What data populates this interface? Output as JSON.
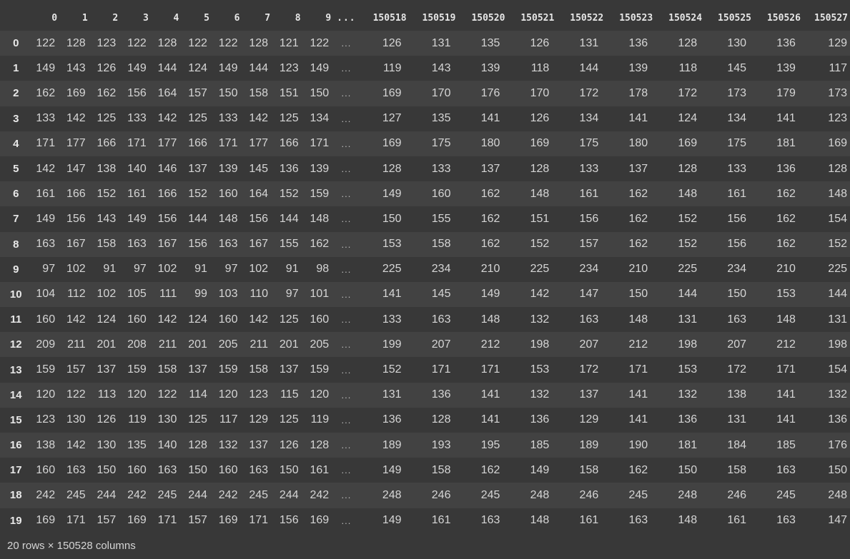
{
  "table": {
    "index_header": "",
    "left_columns": [
      "0",
      "1",
      "2",
      "3",
      "4",
      "5",
      "6",
      "7",
      "8",
      "9"
    ],
    "ellipsis": "...",
    "right_columns": [
      "150518",
      "150519",
      "150520",
      "150521",
      "150522",
      "150523",
      "150524",
      "150525",
      "150526",
      "150527"
    ],
    "rows": [
      {
        "index": "0",
        "left": [
          "122",
          "128",
          "123",
          "122",
          "128",
          "122",
          "122",
          "128",
          "121",
          "122"
        ],
        "right": [
          "126",
          "131",
          "135",
          "126",
          "131",
          "136",
          "128",
          "130",
          "136",
          "129"
        ]
      },
      {
        "index": "1",
        "left": [
          "149",
          "143",
          "126",
          "149",
          "144",
          "124",
          "149",
          "144",
          "123",
          "149"
        ],
        "right": [
          "119",
          "143",
          "139",
          "118",
          "144",
          "139",
          "118",
          "145",
          "139",
          "117"
        ]
      },
      {
        "index": "2",
        "left": [
          "162",
          "169",
          "162",
          "156",
          "164",
          "157",
          "150",
          "158",
          "151",
          "150"
        ],
        "right": [
          "169",
          "170",
          "176",
          "170",
          "172",
          "178",
          "172",
          "173",
          "179",
          "173"
        ]
      },
      {
        "index": "3",
        "left": [
          "133",
          "142",
          "125",
          "133",
          "142",
          "125",
          "133",
          "142",
          "125",
          "134"
        ],
        "right": [
          "127",
          "135",
          "141",
          "126",
          "134",
          "141",
          "124",
          "134",
          "141",
          "123"
        ]
      },
      {
        "index": "4",
        "left": [
          "171",
          "177",
          "166",
          "171",
          "177",
          "166",
          "171",
          "177",
          "166",
          "171"
        ],
        "right": [
          "169",
          "175",
          "180",
          "169",
          "175",
          "180",
          "169",
          "175",
          "181",
          "169"
        ]
      },
      {
        "index": "5",
        "left": [
          "142",
          "147",
          "138",
          "140",
          "146",
          "137",
          "139",
          "145",
          "136",
          "139"
        ],
        "right": [
          "128",
          "133",
          "137",
          "128",
          "133",
          "137",
          "128",
          "133",
          "136",
          "128"
        ]
      },
      {
        "index": "6",
        "left": [
          "161",
          "166",
          "152",
          "161",
          "166",
          "152",
          "160",
          "164",
          "152",
          "159"
        ],
        "right": [
          "149",
          "160",
          "162",
          "148",
          "161",
          "162",
          "148",
          "161",
          "162",
          "148"
        ]
      },
      {
        "index": "7",
        "left": [
          "149",
          "156",
          "143",
          "149",
          "156",
          "144",
          "148",
          "156",
          "144",
          "148"
        ],
        "right": [
          "150",
          "155",
          "162",
          "151",
          "156",
          "162",
          "152",
          "156",
          "162",
          "154"
        ]
      },
      {
        "index": "8",
        "left": [
          "163",
          "167",
          "158",
          "163",
          "167",
          "156",
          "163",
          "167",
          "155",
          "162"
        ],
        "right": [
          "153",
          "158",
          "162",
          "152",
          "157",
          "162",
          "152",
          "156",
          "162",
          "152"
        ]
      },
      {
        "index": "9",
        "left": [
          "97",
          "102",
          "91",
          "97",
          "102",
          "91",
          "97",
          "102",
          "91",
          "98"
        ],
        "right": [
          "225",
          "234",
          "210",
          "225",
          "234",
          "210",
          "225",
          "234",
          "210",
          "225"
        ]
      },
      {
        "index": "10",
        "left": [
          "104",
          "112",
          "102",
          "105",
          "111",
          "99",
          "103",
          "110",
          "97",
          "101"
        ],
        "right": [
          "141",
          "145",
          "149",
          "142",
          "147",
          "150",
          "144",
          "150",
          "153",
          "144"
        ]
      },
      {
        "index": "11",
        "left": [
          "160",
          "142",
          "124",
          "160",
          "142",
          "124",
          "160",
          "142",
          "125",
          "160"
        ],
        "right": [
          "133",
          "163",
          "148",
          "132",
          "163",
          "148",
          "131",
          "163",
          "148",
          "131"
        ]
      },
      {
        "index": "12",
        "left": [
          "209",
          "211",
          "201",
          "208",
          "211",
          "201",
          "205",
          "211",
          "201",
          "205"
        ],
        "right": [
          "199",
          "207",
          "212",
          "198",
          "207",
          "212",
          "198",
          "207",
          "212",
          "198"
        ]
      },
      {
        "index": "13",
        "left": [
          "159",
          "157",
          "137",
          "159",
          "158",
          "137",
          "159",
          "158",
          "137",
          "159"
        ],
        "right": [
          "152",
          "171",
          "171",
          "153",
          "172",
          "171",
          "153",
          "172",
          "171",
          "154"
        ]
      },
      {
        "index": "14",
        "left": [
          "120",
          "122",
          "113",
          "120",
          "122",
          "114",
          "120",
          "123",
          "115",
          "120"
        ],
        "right": [
          "131",
          "136",
          "141",
          "132",
          "137",
          "141",
          "132",
          "138",
          "141",
          "132"
        ]
      },
      {
        "index": "15",
        "left": [
          "123",
          "130",
          "126",
          "119",
          "130",
          "125",
          "117",
          "129",
          "125",
          "119"
        ],
        "right": [
          "136",
          "128",
          "141",
          "136",
          "129",
          "141",
          "136",
          "131",
          "141",
          "136"
        ]
      },
      {
        "index": "16",
        "left": [
          "138",
          "142",
          "130",
          "135",
          "140",
          "128",
          "132",
          "137",
          "126",
          "128"
        ],
        "right": [
          "189",
          "193",
          "195",
          "185",
          "189",
          "190",
          "181",
          "184",
          "185",
          "176"
        ]
      },
      {
        "index": "17",
        "left": [
          "160",
          "163",
          "150",
          "160",
          "163",
          "150",
          "160",
          "163",
          "150",
          "161"
        ],
        "right": [
          "149",
          "158",
          "162",
          "149",
          "158",
          "162",
          "150",
          "158",
          "163",
          "150"
        ]
      },
      {
        "index": "18",
        "left": [
          "242",
          "245",
          "244",
          "242",
          "245",
          "244",
          "242",
          "245",
          "244",
          "242"
        ],
        "right": [
          "248",
          "246",
          "245",
          "248",
          "246",
          "245",
          "248",
          "246",
          "245",
          "248"
        ]
      },
      {
        "index": "19",
        "left": [
          "169",
          "171",
          "157",
          "169",
          "171",
          "157",
          "169",
          "171",
          "156",
          "169"
        ],
        "right": [
          "149",
          "161",
          "163",
          "148",
          "161",
          "163",
          "148",
          "161",
          "163",
          "147"
        ]
      }
    ]
  },
  "footer": {
    "summary": "20 rows × 150528 columns"
  }
}
